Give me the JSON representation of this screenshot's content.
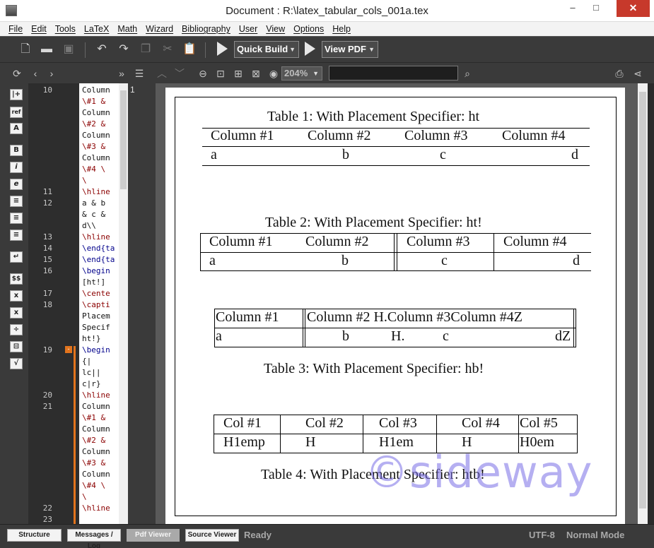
{
  "window": {
    "title": "Document : R:\\latex_tabular_cols_001a.tex",
    "minimize": "–",
    "maximize": "□",
    "close": "✕"
  },
  "menu": [
    "File",
    "Edit",
    "Tools",
    "LaTeX",
    "Math",
    "Wizard",
    "Bibliography",
    "User",
    "View",
    "Options",
    "Help"
  ],
  "toolbar": {
    "quick_build": "Quick Build",
    "view_pdf": "View PDF"
  },
  "pdf_toolbar": {
    "zoom": "204%",
    "search_value": ""
  },
  "editor": {
    "line_numbers": [
      {
        "n": "10",
        "row": 0
      },
      {
        "n": "11",
        "row": 9
      },
      {
        "n": "12",
        "row": 10
      },
      {
        "n": "13",
        "row": 13
      },
      {
        "n": "14",
        "row": 14
      },
      {
        "n": "15",
        "row": 15
      },
      {
        "n": "16",
        "row": 16
      },
      {
        "n": "17",
        "row": 18
      },
      {
        "n": "18",
        "row": 19
      },
      {
        "n": "19",
        "row": 23
      },
      {
        "n": "20",
        "row": 27
      },
      {
        "n": "21",
        "row": 28
      },
      {
        "n": "22",
        "row": 37
      },
      {
        "n": "23",
        "row": 38
      }
    ],
    "lines": [
      {
        "t": "Column",
        "c": ""
      },
      {
        "t": "\\#1 &",
        "c": "kw"
      },
      {
        "t": "Column",
        "c": ""
      },
      {
        "t": "\\#2 &",
        "c": "kw"
      },
      {
        "t": "Column",
        "c": ""
      },
      {
        "t": "\\#3 &",
        "c": "kw"
      },
      {
        "t": "Column",
        "c": ""
      },
      {
        "t": "\\#4 \\",
        "c": "kw"
      },
      {
        "t": "\\",
        "c": "kw"
      },
      {
        "t": "\\hline",
        "c": "kw"
      },
      {
        "t": "a & b",
        "c": ""
      },
      {
        "t": "& c &",
        "c": ""
      },
      {
        "t": "d\\\\",
        "c": ""
      },
      {
        "t": "\\hline",
        "c": "kw"
      },
      {
        "t": "\\end{ta",
        "c": "cmd"
      },
      {
        "t": "\\end{ta",
        "c": "cmd"
      },
      {
        "t": "\\begin",
        "c": "cmd"
      },
      {
        "t": "[ht!]",
        "c": ""
      },
      {
        "t": "\\cente",
        "c": "kw"
      },
      {
        "t": "\\capti",
        "c": "kw"
      },
      {
        "t": "Placem",
        "c": ""
      },
      {
        "t": "Specif",
        "c": ""
      },
      {
        "t": "ht!}",
        "c": ""
      },
      {
        "t": "\\begin",
        "c": "cmd"
      },
      {
        "t": "{|",
        "c": ""
      },
      {
        "t": "lc||",
        "c": ""
      },
      {
        "t": "c|r}",
        "c": ""
      },
      {
        "t": "\\hline",
        "c": "kw"
      },
      {
        "t": "Column",
        "c": ""
      },
      {
        "t": "\\#1 &",
        "c": "kw"
      },
      {
        "t": "Column",
        "c": ""
      },
      {
        "t": "\\#2 &",
        "c": "kw"
      },
      {
        "t": "Column",
        "c": ""
      },
      {
        "t": "\\#3 &",
        "c": "kw"
      },
      {
        "t": "Column",
        "c": ""
      },
      {
        "t": "\\#4 \\",
        "c": "kw"
      },
      {
        "t": "\\",
        "c": "kw"
      },
      {
        "t": "\\hline",
        "c": "kw"
      },
      {
        "t": "",
        "c": ""
      }
    ],
    "fold_marker": "-"
  },
  "pdf": {
    "page_number": "1",
    "table1": {
      "caption": "Table 1: With Placement Specifier: ht",
      "headers": [
        "Column #1",
        "Column #2",
        "Column #3",
        "Column #4"
      ],
      "row": [
        "a",
        "b",
        "c",
        "d"
      ]
    },
    "table2": {
      "caption": "Table 2: With Placement Specifier: ht!",
      "headers": [
        "Column #1",
        "Column #2",
        "Column #3",
        "Column #4"
      ],
      "row": [
        "a",
        "b",
        "c",
        "d"
      ]
    },
    "table3": {
      "caption": "Table 3: With Placement Specifier: hb!",
      "header_a": "Column #1",
      "header_b": "Column #2 H.Column #3Column #4Z",
      "row_a": "a",
      "row_b": "b",
      "row_h": "H.",
      "row_c": "c",
      "row_d": "dZ"
    },
    "table4": {
      "caption": "Table 4: With Placement Specifier: htb!",
      "headers": [
        "Col #1",
        "Col #2",
        "Col #3",
        "Col #4",
        "Col #5"
      ],
      "row": [
        "H1emp",
        "H",
        "H1em",
        "H",
        "H0em"
      ]
    },
    "watermark": "©sideway"
  },
  "status": {
    "tabs": [
      "Structure",
      "Messages / Log",
      "Pdf Viewer",
      "Source Viewer"
    ],
    "ready": "Ready",
    "encoding": "UTF-8",
    "mode": "Normal Mode"
  }
}
